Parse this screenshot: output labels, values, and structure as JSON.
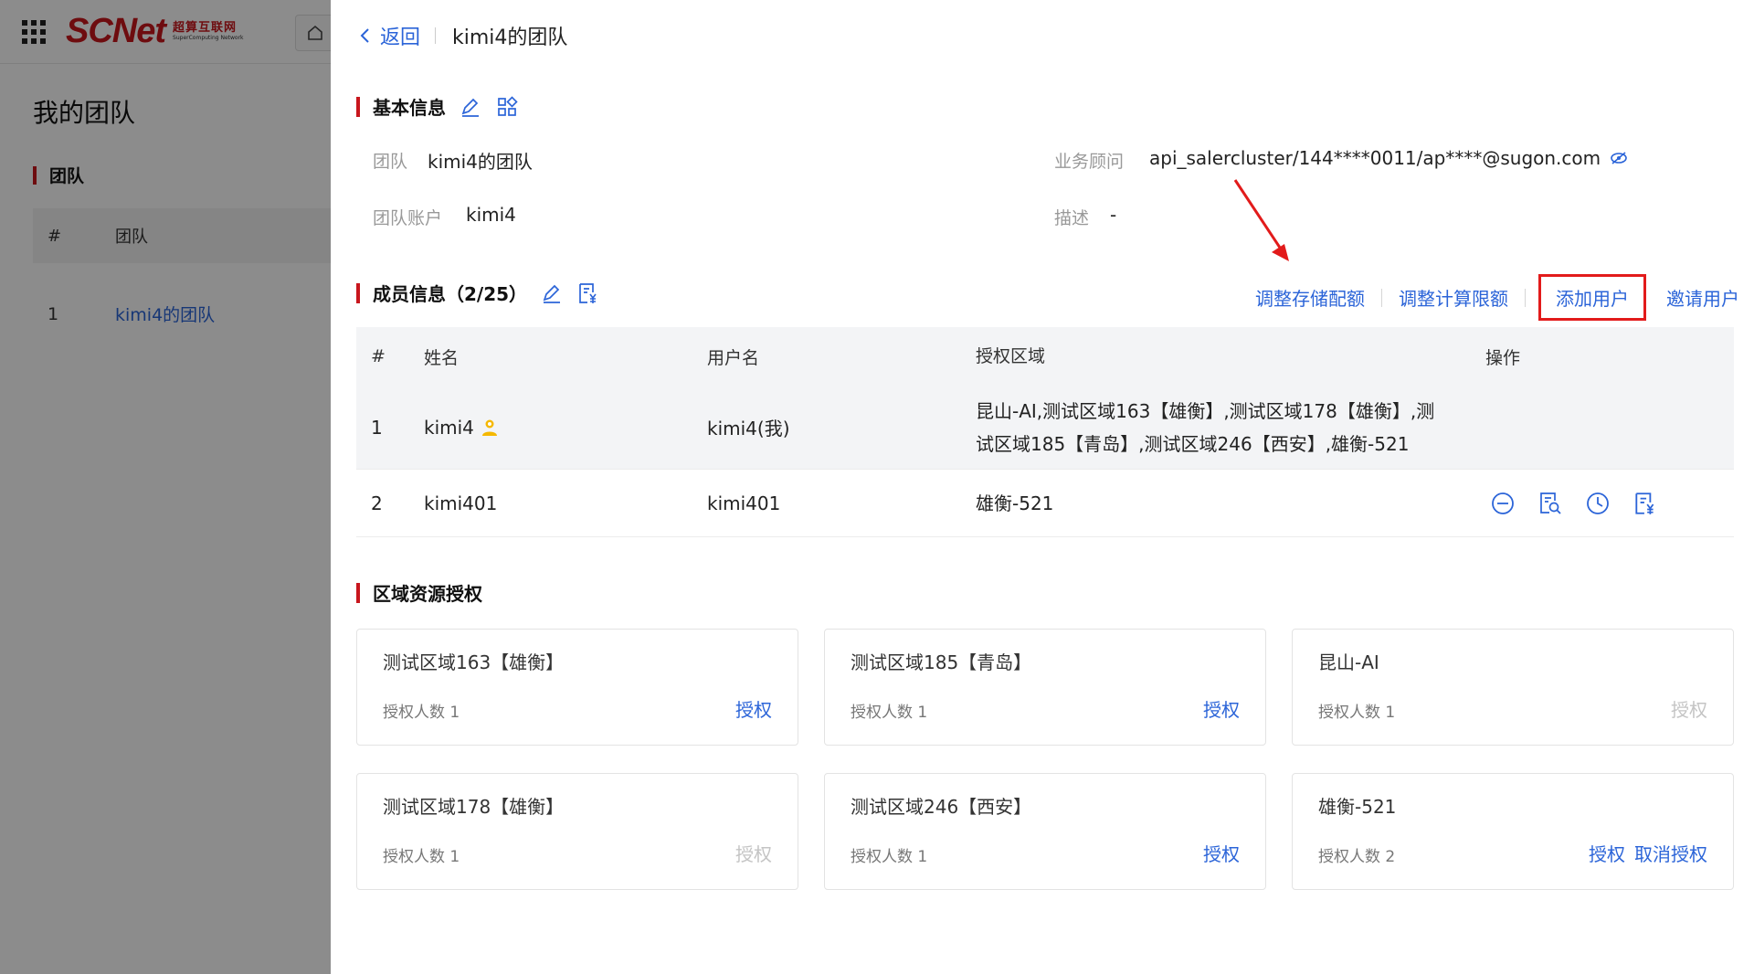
{
  "brand": {
    "name_main": "SCNet",
    "name_cn": "超算互联网",
    "name_en": "SuperComputing Network"
  },
  "background": {
    "page_title": "我的团队",
    "section_title": "团队",
    "table_headers": [
      "#",
      "团队"
    ],
    "rows": [
      {
        "index": "1",
        "name": "kimi4的团队"
      }
    ]
  },
  "drawer": {
    "back_label": "返回",
    "title": "kimi4的团队",
    "basic": {
      "title": "基本信息",
      "team_label": "团队",
      "team_value": "kimi4的团队",
      "account_label": "团队账户",
      "account_value": "kimi4",
      "advisor_label": "业务顾问",
      "advisor_value": "api_salercluster/144****0011/ap****@sugon.com",
      "desc_label": "描述",
      "desc_value": "-"
    },
    "members": {
      "title": "成员信息（2/25）",
      "actions": [
        "调整存储配额",
        "调整计算限额",
        "添加用户",
        "邀请用户"
      ],
      "headers": [
        "#",
        "姓名",
        "用户名",
        "授权区域",
        "操作"
      ],
      "rows": [
        {
          "index": "1",
          "name": "kimi4",
          "username": "kimi4(我)",
          "regions_line1": "昆山-AI,测试区域163【雄衡】,测试区域178【雄衡】,测",
          "regions_line2": "试区域185【青岛】,测试区域246【西安】,雄衡-521"
        },
        {
          "index": "2",
          "name": "kimi401",
          "username": "kimi401",
          "regions_line1": "雄衡-521",
          "regions_line2": ""
        }
      ]
    },
    "regions": {
      "title": "区域资源授权",
      "cards": [
        {
          "name": "测试区域163【雄衡】",
          "count": "授权人数 1",
          "auth": "授权",
          "auth_enabled": true,
          "revoke": ""
        },
        {
          "name": "测试区域185【青岛】",
          "count": "授权人数 1",
          "auth": "授权",
          "auth_enabled": true,
          "revoke": ""
        },
        {
          "name": "昆山-AI",
          "count": "授权人数 1",
          "auth": "授权",
          "auth_enabled": false,
          "revoke": ""
        },
        {
          "name": "测试区域178【雄衡】",
          "count": "授权人数 1",
          "auth": "授权",
          "auth_enabled": false,
          "revoke": ""
        },
        {
          "name": "测试区域246【西安】",
          "count": "授权人数 1",
          "auth": "授权",
          "auth_enabled": true,
          "revoke": ""
        },
        {
          "name": "雄衡-521",
          "count": "授权人数 2",
          "auth": "授权",
          "auth_enabled": true,
          "revoke": "取消授权"
        }
      ]
    }
  },
  "colors": {
    "accent": "#2b64d8",
    "brand_red": "#c8161d",
    "highlight": "#e21b1b",
    "admin_badge": "#f5b800"
  },
  "icons": [
    "app-grid-icon",
    "home-icon",
    "chevron-left-icon",
    "edit-icon",
    "grid-icon",
    "doc-yen-icon",
    "admin-badge-icon",
    "remove-member-icon",
    "doc-search-icon",
    "clock-icon",
    "eye-off-icon",
    "annotation-arrow-icon"
  ]
}
